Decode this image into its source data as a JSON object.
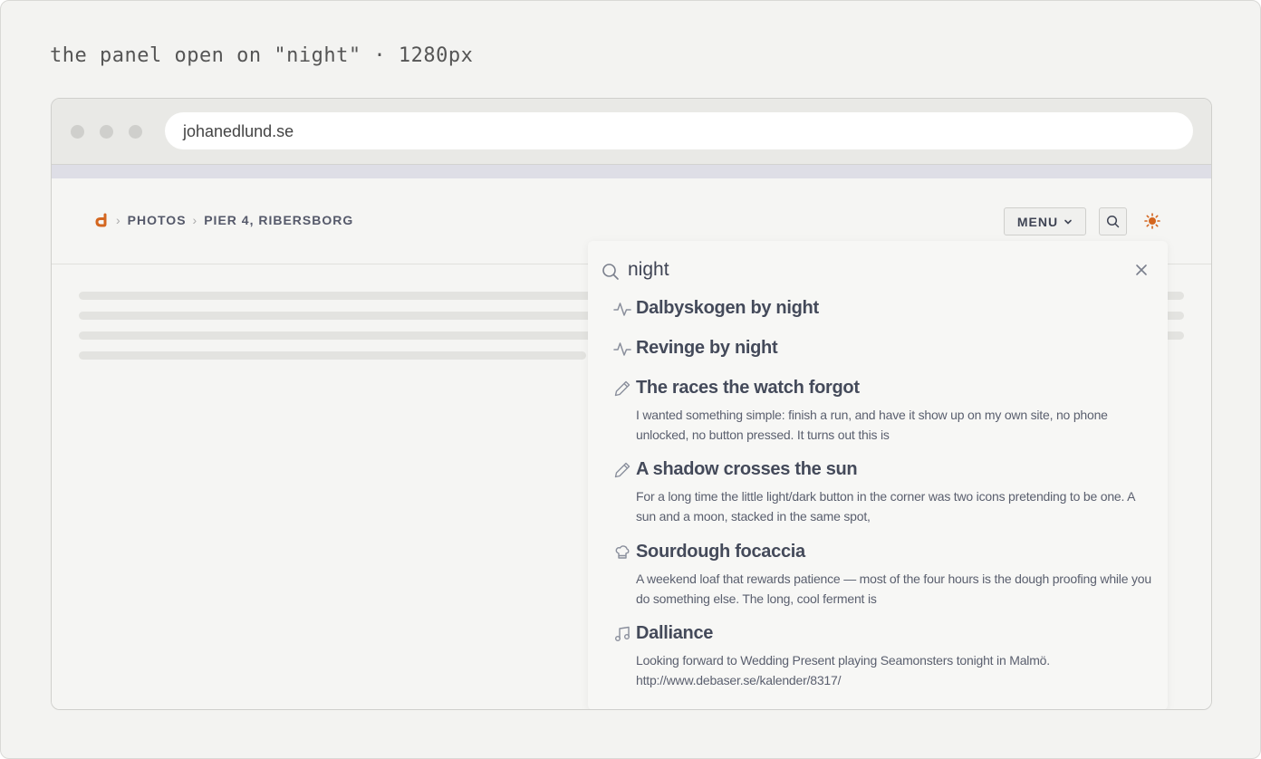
{
  "caption": "the panel open on \"night\" · 1280px",
  "browser": {
    "url": "johanedlund.se"
  },
  "breadcrumb": {
    "items": [
      "PHOTOS",
      "PIER 4, RIBERSBORG"
    ]
  },
  "header": {
    "menu_label": "MENU"
  },
  "search": {
    "query": "night",
    "results": [
      {
        "icon": "activity-icon",
        "title": "Dalbyskogen by night",
        "snippet": ""
      },
      {
        "icon": "activity-icon",
        "title": "Revinge by night",
        "snippet": ""
      },
      {
        "icon": "pencil-icon",
        "title": "The races the watch forgot",
        "snippet": "I wanted something simple: finish a run, and have it show up on my own site, no phone unlocked, no button pressed. It turns out this is"
      },
      {
        "icon": "pencil-icon",
        "title": "A shadow crosses the sun",
        "snippet": "For a long time the little light/dark button in the corner was two icons pretending to be one. A sun and a moon, stacked in the same spot,"
      },
      {
        "icon": "chef-hat-icon",
        "title": "Sourdough focaccia",
        "snippet": "A weekend loaf that rewards patience — most of the four hours is the dough proofing while you do something else. The long, cool ferment is"
      },
      {
        "icon": "music-icon",
        "title": "Dalliance",
        "snippet": "Looking forward to Wedding Present playing Seamonsters tonight in Malmö. http://www.debaser.se/kalender/8317/"
      }
    ]
  },
  "colors": {
    "accent": "#d4661f",
    "text": "#444a5a",
    "background": "#f3f3f1"
  }
}
